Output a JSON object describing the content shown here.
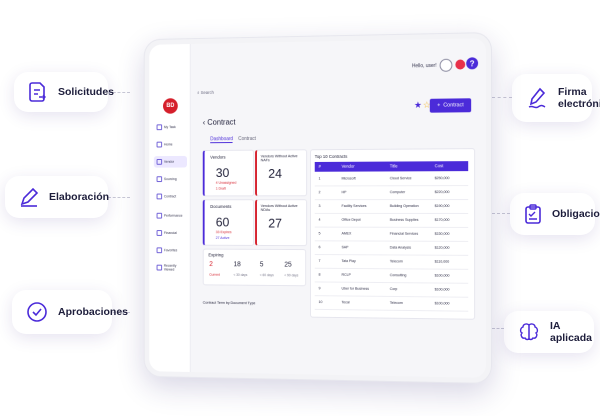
{
  "features": {
    "solicitudes": "Solicitudes",
    "elaboracion": "Elaboración",
    "aprobaciones": "Aprobaciones",
    "firma_line1": "Firma",
    "firma_line2": "electrónica",
    "obligaciones": "Obligaciones",
    "ia": "IA aplicada"
  },
  "app": {
    "logo_text": "BD",
    "search_label": "Search",
    "greeting": "Hello, user!",
    "page_title": "Contract",
    "new_contract": "Contract",
    "tabs": [
      "Dashboard",
      "Contract"
    ],
    "nav": [
      "My Task",
      "Home",
      "Vendor",
      "Sourcing",
      "Contract",
      "Performance",
      "Financial",
      "Favorites",
      "Recently Viewed"
    ]
  },
  "dashboard": {
    "vendors": {
      "title": "Vendors",
      "value": "30",
      "line1": "4 Unassigned",
      "line2": "1 Draft"
    },
    "vendors_without_ndas": {
      "title": "Vendors Without Active NAFs",
      "value": "24"
    },
    "documents": {
      "title": "Documents",
      "value": "60",
      "line1": "33 Expires",
      "line2": "27 Active"
    },
    "vendors_without_ndas_2": {
      "title": "Vendors Without Active NDAs",
      "value": "27"
    },
    "expiring": {
      "title": "Expiring",
      "items": [
        {
          "value": "2",
          "label": "Current"
        },
        {
          "value": "18",
          "label": "< 30 days"
        },
        {
          "value": "5",
          "label": "< 60 days"
        },
        {
          "value": "25",
          "label": "< 90 days"
        }
      ]
    },
    "contract_term_label": "Contract Term by Document Type"
  },
  "top_contracts": {
    "title": "Top 10 Contracts",
    "headers": [
      "#",
      "Vendor",
      "Title",
      "Cost"
    ],
    "rows": [
      [
        "1",
        "Microsoft",
        "Cloud Service",
        "$250,000"
      ],
      [
        "2",
        "HP",
        "Computer",
        "$220,000"
      ],
      [
        "3",
        "Facility Services",
        "Building Operation",
        "$190,000"
      ],
      [
        "4",
        "Office Depot",
        "Business Supplies",
        "$170,000"
      ],
      [
        "5",
        "AMEX",
        "Financial Services",
        "$150,000"
      ],
      [
        "6",
        "SAP",
        "Data Analysis",
        "$120,000"
      ],
      [
        "7",
        "Tata Play",
        "Telecom",
        "$110,000"
      ],
      [
        "8",
        "RCLP",
        "Consulting",
        "$100,000"
      ],
      [
        "9",
        "Uber for Business",
        "Corp",
        "$100,000"
      ],
      [
        "10",
        "Tecal",
        "Telecom",
        "$100,000"
      ]
    ]
  },
  "colors": {
    "accent": "#4b2bd9",
    "brand_red": "#d51f2b",
    "text": "#1d1d3b"
  }
}
